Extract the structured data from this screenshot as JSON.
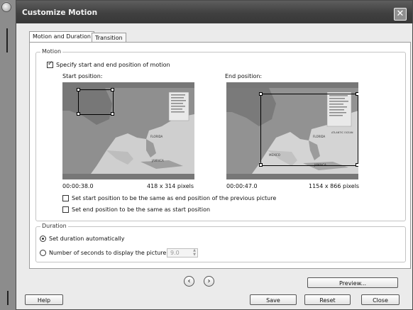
{
  "window": {
    "title": "Customize Motion",
    "close_symbol": "✕"
  },
  "tabs": [
    {
      "label": "Motion and Duration",
      "active": true
    },
    {
      "label": "Transition",
      "active": false
    }
  ],
  "motion": {
    "group_label": "Motion",
    "specify_label": "Specify start and end position of motion",
    "specify_checked": true,
    "start": {
      "title": "Start position:",
      "time": "00:00:38.0",
      "size": "418 x 314 pixels"
    },
    "end": {
      "title": "End position:",
      "time": "00:00:47.0",
      "size": "1154 x 866 pixels"
    },
    "option_same_as_prev": "Set start position to be the same as end position of the previous picture",
    "option_end_same_as_start": "Set end position to be the same as start position",
    "map_labels": {
      "florida": "FLORIDA",
      "jamaica": "JAMAICA",
      "mexico": "MEXICO",
      "atlantic": "ATLANTIC OCEAN"
    }
  },
  "duration": {
    "group_label": "Duration",
    "auto_label": "Set duration automatically",
    "auto_selected": true,
    "seconds_label": "Number of seconds to display the picture",
    "seconds_value": "9.0"
  },
  "nav": {
    "prev_symbol": "‹",
    "next_symbol": "›"
  },
  "buttons": {
    "preview": "Preview...",
    "help": "Help",
    "save": "Save",
    "reset": "Reset",
    "close": "Close"
  },
  "colors": {
    "titlebar": "#444444",
    "dialog_bg": "#ebebeb",
    "panel_bg": "#ffffff"
  }
}
